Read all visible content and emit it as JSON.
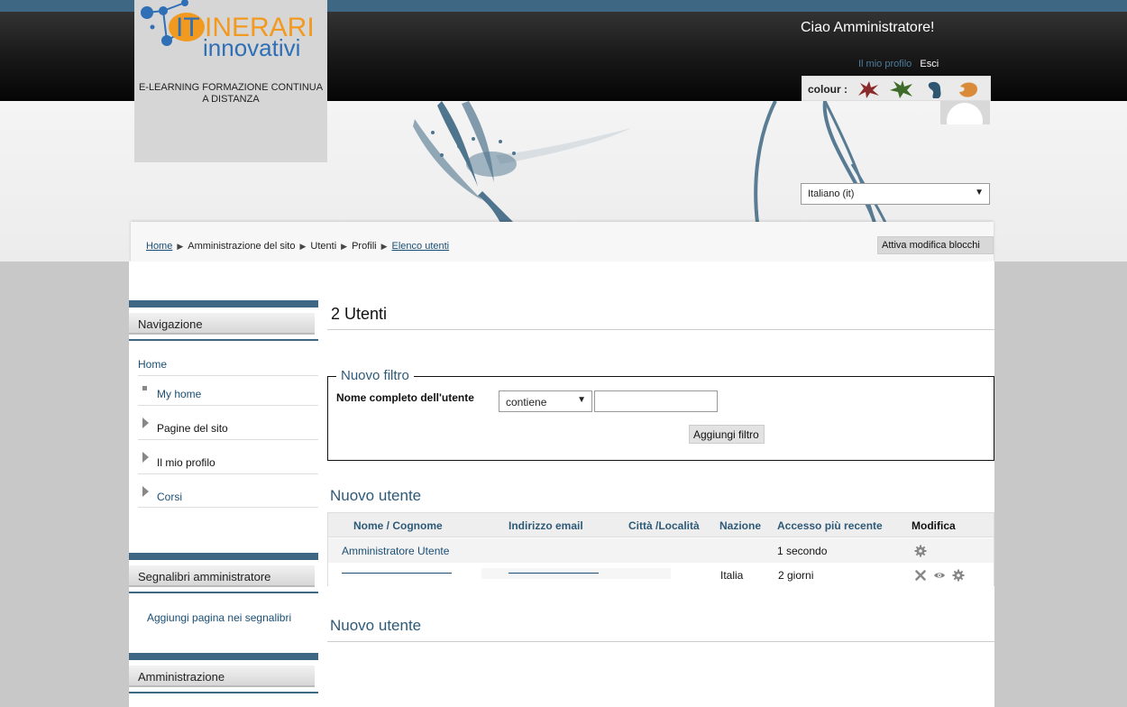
{
  "header": {
    "logo": {
      "word1": "IT",
      "word2": "INERARI",
      "word3": "innovativi",
      "tagline": "E-LEARNING FORMAZIONE CONTINUA A DISTANZA"
    },
    "greeting": "Ciao Amministratore!",
    "links": {
      "profile": "Il mio profilo",
      "logout": "Esci"
    },
    "colour_label": "colour :",
    "colours": [
      "#8b2a2a",
      "#3f6b2a",
      "#2f5670",
      "#d98b3a"
    ],
    "language": "Italiano (it)"
  },
  "breadcrumb": {
    "items": [
      "Home",
      "Amministrazione del sito",
      "Utenti",
      "Profili",
      "Elenco utenti"
    ],
    "edit_blocks": "Attiva modifica blocchi"
  },
  "sidebar": {
    "navigation": {
      "title": "Navigazione",
      "home": "Home",
      "items": [
        "My home",
        "Pagine del sito",
        "Il mio profilo",
        "Corsi"
      ]
    },
    "bookmarks": {
      "title": "Segnalibri amministratore",
      "link": "Aggiungi pagina nei segnalibri"
    },
    "admin": {
      "title": "Amministrazione"
    }
  },
  "main": {
    "title": "2 Utenti",
    "filter": {
      "legend": "Nuovo filtro",
      "label": "Nome completo dell'utente",
      "operator": "contiene",
      "value": "",
      "button": "Aggiungi filtro"
    },
    "new_user_label": "Nuovo utente",
    "table": {
      "headers": [
        "Nome / Cognome",
        "Indirizzo email",
        "Città /Località",
        "Nazione",
        "Accesso più recente",
        "Modifica"
      ],
      "rows": [
        {
          "name": "Amministratore Utente",
          "email": "",
          "city": "",
          "country": "",
          "last_access": "1 secondo"
        },
        {
          "name": "",
          "email": "",
          "city": "",
          "country": "Italia",
          "last_access": "2 giorni"
        }
      ]
    }
  }
}
